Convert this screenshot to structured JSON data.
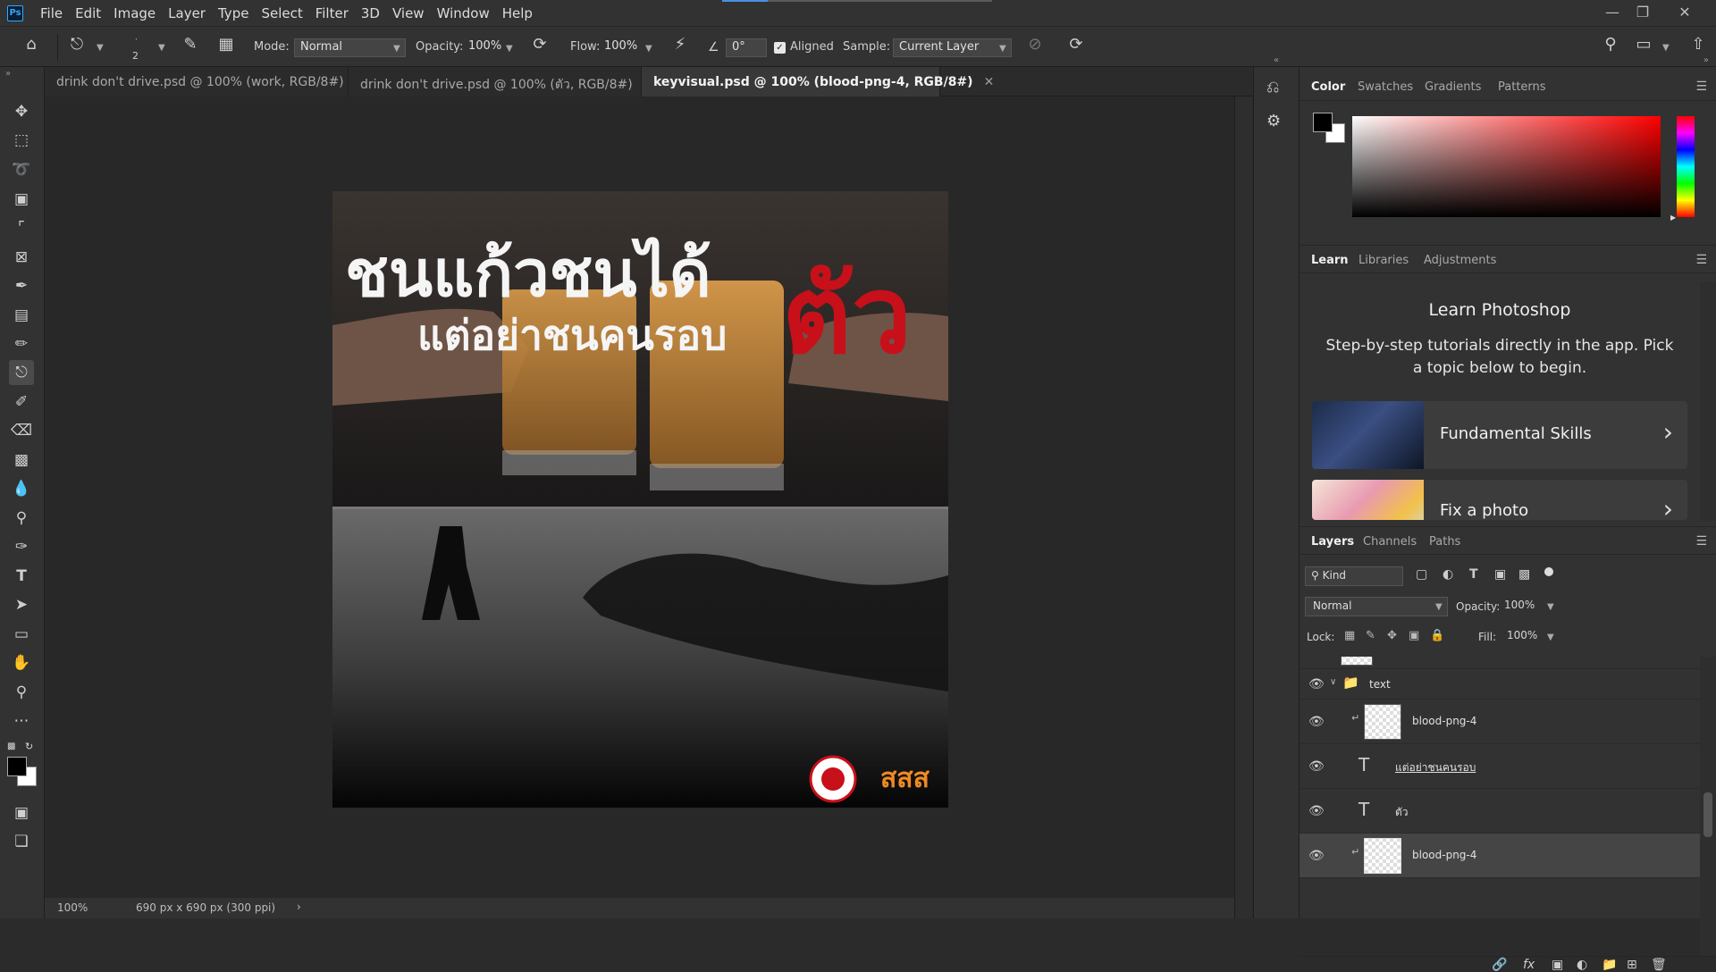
{
  "app": {
    "logo": "Ps"
  },
  "menu": [
    "File",
    "Edit",
    "Image",
    "Layer",
    "Type",
    "Select",
    "Filter",
    "3D",
    "View",
    "Window",
    "Help"
  ],
  "menu_progress": 0.17,
  "options": {
    "brush_size": "2",
    "mode_label": "Mode:",
    "mode_value": "Normal",
    "opacity_label": "Opacity:",
    "opacity_value": "100%",
    "flow_label": "Flow:",
    "flow_value": "100%",
    "angle_value": "0°",
    "aligned_label": "Aligned",
    "aligned_checked": true,
    "sample_label": "Sample:",
    "sample_value": "Current Layer"
  },
  "tabs": [
    {
      "label": "drink don't drive.psd @ 100% (work, RGB/8#)",
      "active": false
    },
    {
      "label": "drink don't drive.psd @ 100% (ตัว, RGB/8#)",
      "active": false
    },
    {
      "label": "keyvisual.psd @ 100% (blood-png-4, RGB/8#)",
      "active": true
    }
  ],
  "artwork": {
    "headline": "ชนแก้วชนได้",
    "subline": "แต่อย่าชนคนรอบ",
    "red_word": "ตัว",
    "logo2_text": "สสส",
    "headline_color": "#f5f5f5",
    "accent_color": "#c8101a"
  },
  "status": {
    "zoom": "100%",
    "doc_info": "690 px x 690 px (300 ppi)"
  },
  "color_panel": {
    "tabs": [
      "Color",
      "Swatches",
      "Gradients",
      "Patterns"
    ],
    "foreground": "#000000",
    "background": "#ffffff",
    "hue": "#ff0000"
  },
  "learn_panel": {
    "tabs": [
      "Learn",
      "Libraries",
      "Adjustments"
    ],
    "title": "Learn Photoshop",
    "description": "Step-by-step tutorials directly in the app. Pick a topic below to begin.",
    "cards": [
      "Fundamental Skills",
      "Fix a photo"
    ]
  },
  "layers_panel": {
    "tabs": [
      "Layers",
      "Channels",
      "Paths"
    ],
    "filter_kind": "Kind",
    "blend_mode": "Normal",
    "opacity_label": "Opacity:",
    "opacity_value": "100%",
    "lock_label": "Lock:",
    "fill_label": "Fill:",
    "fill_value": "100%",
    "layers": [
      {
        "name": "text",
        "type": "group",
        "selected": false
      },
      {
        "name": "blood-png-4",
        "type": "image",
        "selected": false
      },
      {
        "name": "แต่อย่าชนคนรอบ",
        "type": "text",
        "selected": false
      },
      {
        "name": "ตัว",
        "type": "text",
        "selected": false
      },
      {
        "name": "blood-png-4",
        "type": "image",
        "selected": true
      }
    ]
  }
}
